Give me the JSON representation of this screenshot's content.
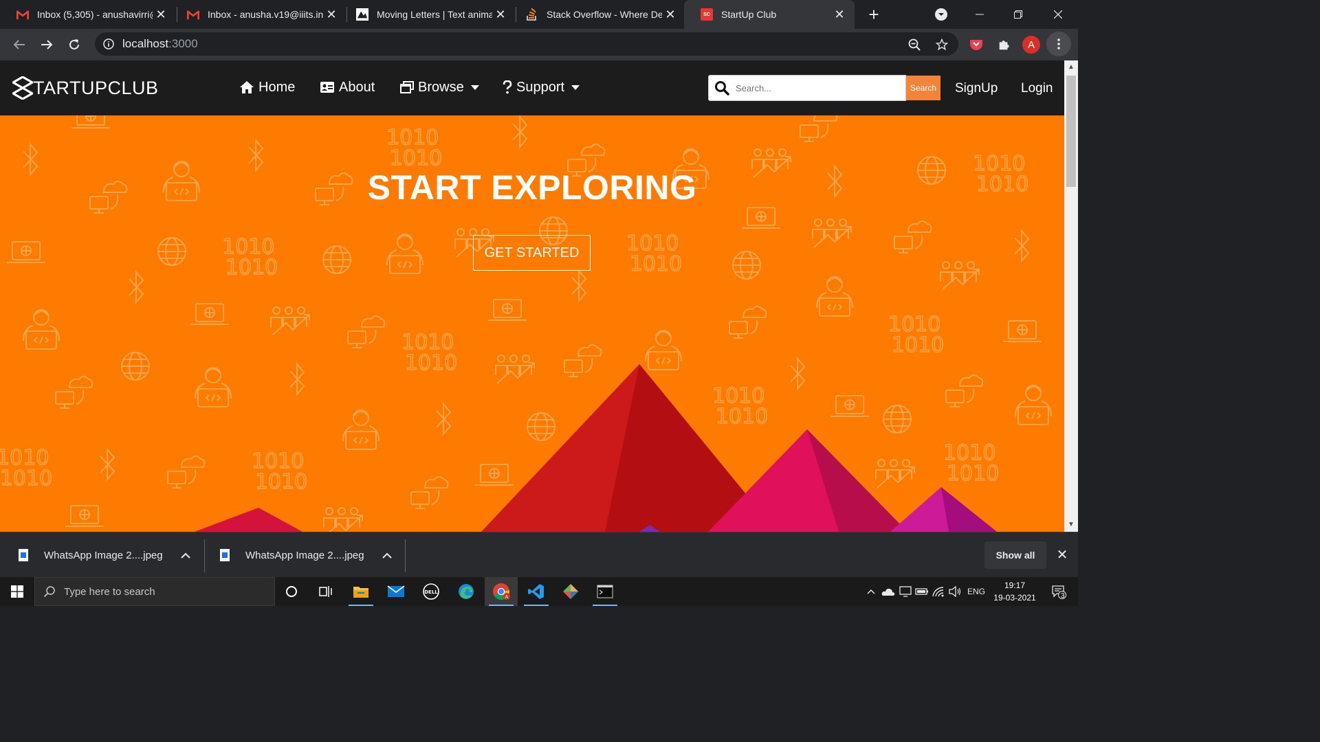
{
  "browser": {
    "tabs": [
      {
        "title": "Inbox (5,305) - anushavirri@",
        "icon": "gmail-icon"
      },
      {
        "title": "Inbox - anusha.v19@iiits.in",
        "icon": "gmail-icon"
      },
      {
        "title": "Moving Letters | Text anima",
        "icon": "moving-letters-icon"
      },
      {
        "title": "Stack Overflow - Where De",
        "icon": "stackoverflow-icon"
      },
      {
        "title": "StartUp Club",
        "icon": "startup-club-icon",
        "favicon_text": "SC",
        "active": true
      }
    ],
    "profile_initial": "A",
    "address": {
      "host": "localhost",
      "port": ":3000"
    }
  },
  "site": {
    "logo_text": "TARTUPCLUB",
    "nav": {
      "home": "Home",
      "about": "About",
      "browse": "Browse",
      "support": "Support"
    },
    "search": {
      "placeholder": "Search...",
      "button": "Search"
    },
    "signup": "SignUp",
    "login": "Login",
    "hero": {
      "title": "START EXPLORING",
      "cta": "GET STARTED"
    },
    "pattern_text": "1010",
    "colors": {
      "navbar": "#1c1c1c",
      "hero_bg": "#ff7b00",
      "search_button": "#f0853a"
    }
  },
  "downloads": {
    "items": [
      {
        "name": "WhatsApp Image 2....jpeg"
      },
      {
        "name": "WhatsApp Image 2....jpeg"
      }
    ],
    "show_all": "Show all"
  },
  "taskbar": {
    "search_placeholder": "Type here to search",
    "language": "ENG",
    "time": "19:17",
    "date": "19-03-2021",
    "notification_count": "3"
  }
}
